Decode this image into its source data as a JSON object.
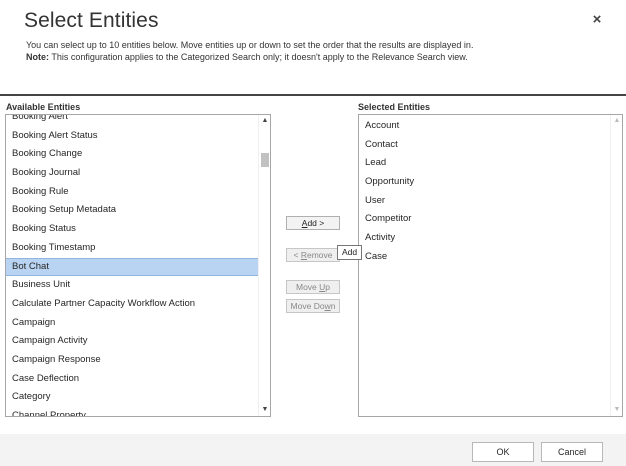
{
  "dialog": {
    "title": "Select Entities",
    "close_glyph": "×",
    "description": "You can select up to 10 entities below. Move entities up or down to set the order that the results are displayed in.",
    "note_label": "Note:",
    "note_text": " This configuration applies to the Categorized Search only; it doesn't apply to the Relevance Search view."
  },
  "available": {
    "label": "Available Entities",
    "items": [
      "Booking Alert",
      "Booking Alert Status",
      "Booking Change",
      "Booking Journal",
      "Booking Rule",
      "Booking Setup Metadata",
      "Booking Status",
      "Booking Timestamp",
      "Bot Chat",
      "Business Unit",
      "Calculate Partner Capacity Workflow Action",
      "Campaign",
      "Campaign Activity",
      "Campaign Response",
      "Case Deflection",
      "Category",
      "Channel Property"
    ],
    "selected_item": "Bot Chat"
  },
  "selected": {
    "label": "Selected Entities",
    "items": [
      "Account",
      "Contact",
      "Lead",
      "Opportunity",
      "User",
      "Competitor",
      "Activity",
      "Case"
    ]
  },
  "buttons": {
    "add_prefix": "",
    "add_access": "A",
    "add_rest": "dd >",
    "remove_prefix": "< ",
    "remove_access": "R",
    "remove_rest": "emove",
    "move_up_prefix": "Move ",
    "move_up_access": "U",
    "move_up_rest": "p",
    "move_down_prefix": "Move Do",
    "move_down_access": "w",
    "move_down_rest": "n"
  },
  "tooltip": "Add",
  "footer": {
    "ok_label": "OK",
    "cancel_label": "Cancel"
  },
  "icons": {
    "scroll_up": "▲",
    "scroll_down": "▼"
  }
}
